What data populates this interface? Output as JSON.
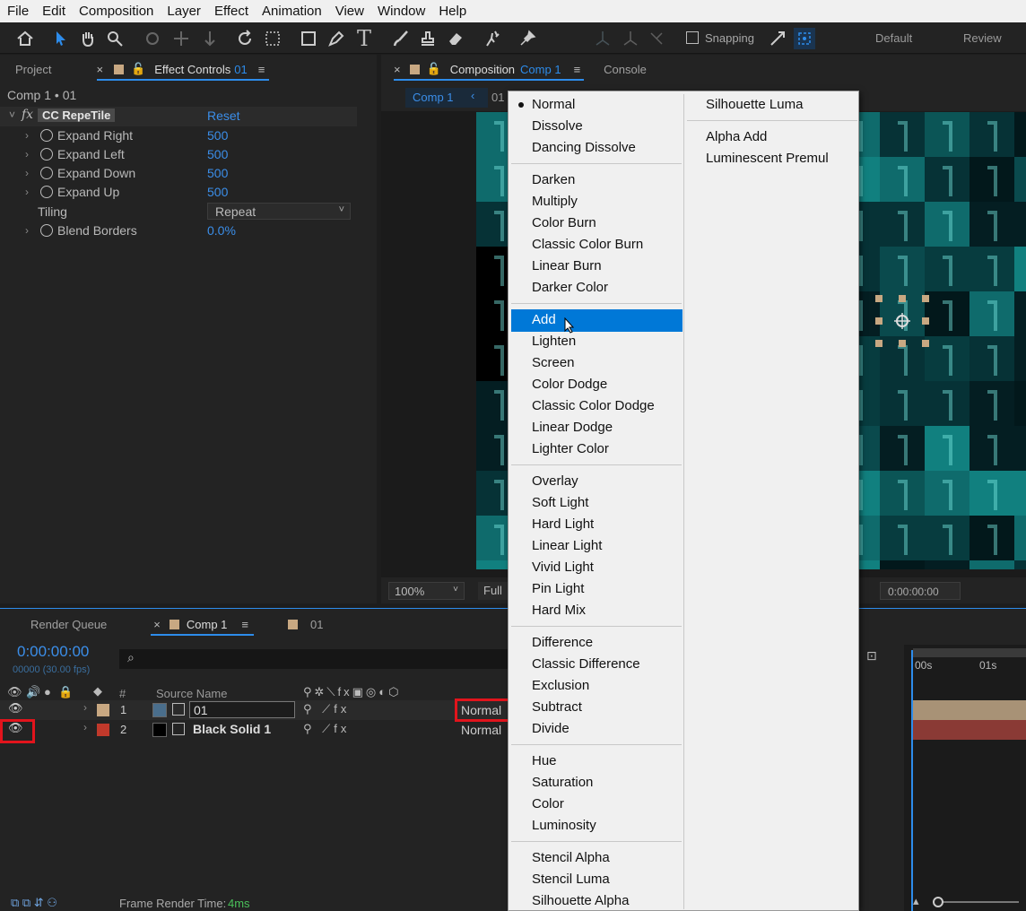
{
  "menubar": [
    "File",
    "Edit",
    "Composition",
    "Layer",
    "Effect",
    "Animation",
    "View",
    "Window",
    "Help"
  ],
  "toolbar": {
    "snapping": "Snapping",
    "workspace_default": "Default",
    "workspace_review": "Review"
  },
  "effect_panel": {
    "tab_project": "Project",
    "tab_effect_controls": "Effect Controls",
    "tab_effect_layer": "01",
    "header": "Comp 1 • 01",
    "effect_name": "CC RepeTile",
    "fx": "fx",
    "reset": "Reset",
    "params": [
      {
        "name": "Expand Right",
        "value": "500"
      },
      {
        "name": "Expand Left",
        "value": "500"
      },
      {
        "name": "Expand Down",
        "value": "500"
      },
      {
        "name": "Expand Up",
        "value": "500"
      }
    ],
    "tiling_label": "Tiling",
    "tiling_value": "Repeat",
    "blend_label": "Blend Borders",
    "blend_value": "0.0%"
  },
  "comp_panel": {
    "tab_composition": "Composition",
    "comp_name": "Comp 1",
    "tab_console": "Console",
    "subtab": "Comp 1",
    "subtab2": "01",
    "zoom": "100%",
    "resolution": "Full",
    "timecode": "0:00:00:00"
  },
  "timeline": {
    "tab_render_queue": "Render Queue",
    "tab_comp": "Comp 1",
    "tab_layer": "01",
    "timecode": "0:00:00:00",
    "frames": "00000 (30.00 fps)",
    "search_icon": "search-icon",
    "col_num": "#",
    "col_source": "Source Name",
    "ruler_0": "00s",
    "ruler_1": "01s",
    "layers": [
      {
        "num": "1",
        "name": "01",
        "mode": "Normal",
        "color": "#c8a882"
      },
      {
        "num": "2",
        "name": "Black Solid 1",
        "mode": "Normal",
        "color": "#c0392b"
      }
    ],
    "render_time_label": "Frame Render Time:",
    "render_time_value": "4ms"
  },
  "blend_menu": {
    "selected": "Normal",
    "highlighted": "Add",
    "col1": [
      "Normal",
      "Dissolve",
      "Dancing Dissolve",
      "Darken",
      "Multiply",
      "Color Burn",
      "Classic Color Burn",
      "Linear Burn",
      "Darker Color",
      "Add",
      "Lighten",
      "Screen",
      "Color Dodge",
      "Classic Color Dodge",
      "Linear Dodge",
      "Lighter Color",
      "Overlay",
      "Soft Light",
      "Hard Light",
      "Linear Light",
      "Vivid Light",
      "Pin Light",
      "Hard Mix",
      "Difference",
      "Classic Difference",
      "Exclusion",
      "Subtract",
      "Divide",
      "Hue",
      "Saturation",
      "Color",
      "Luminosity",
      "Stencil Alpha",
      "Stencil Luma",
      "Silhouette Alpha"
    ],
    "col2": [
      "Silhouette Luma",
      "Alpha Add",
      "Luminescent Premul"
    ]
  },
  "colors": {
    "accent": "#2d8ceb",
    "highlight": "#0078d7",
    "annotation": "#e2141c"
  }
}
